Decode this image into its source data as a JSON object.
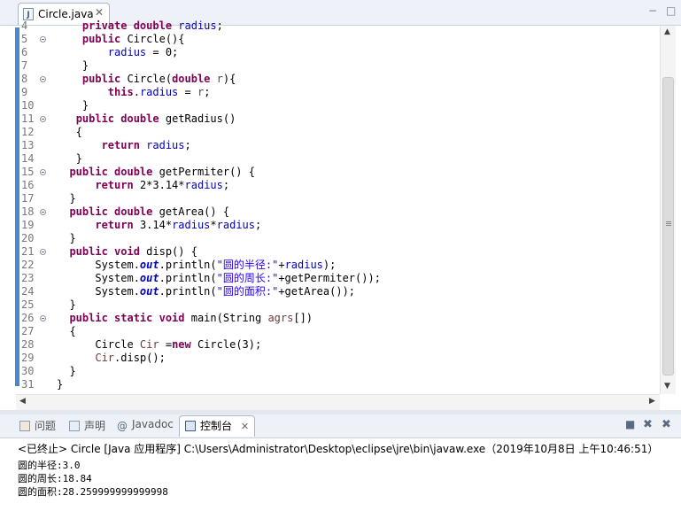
{
  "editor_tab": {
    "filename": "Circle.java",
    "close_glyph": "✕"
  },
  "window_controls": {
    "minimize": "−",
    "maximize": "□"
  },
  "code_lines": [
    {
      "n": "4",
      "fold": false,
      "tokens": [
        [
          "    ",
          ""
        ],
        [
          "private double ",
          "kw"
        ],
        [
          "radius",
          "fld"
        ],
        [
          ";",
          ""
        ]
      ]
    },
    {
      "n": "5",
      "fold": true,
      "tokens": [
        [
          "    ",
          ""
        ],
        [
          "public ",
          "kw"
        ],
        [
          "Circle(){",
          ""
        ]
      ]
    },
    {
      "n": "6",
      "fold": false,
      "tokens": [
        [
          "        ",
          ""
        ],
        [
          "radius",
          "fld"
        ],
        [
          " = 0;",
          ""
        ]
      ]
    },
    {
      "n": "7",
      "fold": false,
      "tokens": [
        [
          "    }",
          ""
        ]
      ]
    },
    {
      "n": "8",
      "fold": true,
      "tokens": [
        [
          "    ",
          ""
        ],
        [
          "public ",
          "kw"
        ],
        [
          "Circle(",
          ""
        ],
        [
          "double ",
          "kw"
        ],
        [
          "r",
          "vr"
        ],
        [
          "){",
          ""
        ]
      ]
    },
    {
      "n": "9",
      "fold": false,
      "tokens": [
        [
          "        ",
          ""
        ],
        [
          "this",
          "kw"
        ],
        [
          ".",
          ""
        ],
        [
          "radius",
          "fld"
        ],
        [
          " = ",
          ""
        ],
        [
          "r",
          "vr"
        ],
        [
          ";",
          ""
        ]
      ]
    },
    {
      "n": "10",
      "fold": false,
      "tokens": [
        [
          "    }",
          ""
        ]
      ]
    },
    {
      "n": "11",
      "fold": true,
      "tokens": [
        [
          "   ",
          ""
        ],
        [
          "public double ",
          "kw"
        ],
        [
          "getRadius()",
          ""
        ]
      ]
    },
    {
      "n": "12",
      "fold": false,
      "tokens": [
        [
          "   {",
          ""
        ]
      ]
    },
    {
      "n": "13",
      "fold": false,
      "tokens": [
        [
          "       ",
          ""
        ],
        [
          "return ",
          "kw"
        ],
        [
          "radius",
          "fld"
        ],
        [
          ";",
          ""
        ]
      ]
    },
    {
      "n": "14",
      "fold": false,
      "tokens": [
        [
          "   }",
          ""
        ]
      ]
    },
    {
      "n": "15",
      "fold": true,
      "tokens": [
        [
          "  ",
          ""
        ],
        [
          "public double ",
          "kw"
        ],
        [
          "getPermiter() {",
          ""
        ]
      ]
    },
    {
      "n": "16",
      "fold": false,
      "tokens": [
        [
          "      ",
          ""
        ],
        [
          "return ",
          "kw"
        ],
        [
          "2*3.14*",
          ""
        ],
        [
          "radius",
          "fld"
        ],
        [
          ";",
          ""
        ]
      ]
    },
    {
      "n": "17",
      "fold": false,
      "tokens": [
        [
          "  }",
          ""
        ]
      ]
    },
    {
      "n": "18",
      "fold": true,
      "tokens": [
        [
          "  ",
          ""
        ],
        [
          "public double ",
          "kw"
        ],
        [
          "getArea() {",
          ""
        ]
      ]
    },
    {
      "n": "19",
      "fold": false,
      "tokens": [
        [
          "      ",
          ""
        ],
        [
          "return ",
          "kw"
        ],
        [
          "3.14*",
          ""
        ],
        [
          "radius",
          "fld"
        ],
        [
          "*",
          ""
        ],
        [
          "radius",
          "fld"
        ],
        [
          ";",
          ""
        ]
      ]
    },
    {
      "n": "20",
      "fold": false,
      "tokens": [
        [
          "  }",
          ""
        ]
      ]
    },
    {
      "n": "21",
      "fold": true,
      "tokens": [
        [
          "  ",
          ""
        ],
        [
          "public void ",
          "kw"
        ],
        [
          "disp() {",
          ""
        ]
      ]
    },
    {
      "n": "22",
      "fold": false,
      "tokens": [
        [
          "      System.",
          ""
        ],
        [
          "out",
          "sta"
        ],
        [
          ".println(",
          ""
        ],
        [
          "\"圆的半径:\"",
          "str"
        ],
        [
          "+",
          ""
        ],
        [
          "radius",
          "fld"
        ],
        [
          ");",
          ""
        ]
      ]
    },
    {
      "n": "23",
      "fold": false,
      "tokens": [
        [
          "      System.",
          ""
        ],
        [
          "out",
          "sta"
        ],
        [
          ".println(",
          ""
        ],
        [
          "\"圆的周长:\"",
          "str"
        ],
        [
          "+getPermiter());",
          ""
        ]
      ]
    },
    {
      "n": "24",
      "fold": false,
      "tokens": [
        [
          "      System.",
          ""
        ],
        [
          "out",
          "sta"
        ],
        [
          ".println(",
          ""
        ],
        [
          "\"圆的面积:\"",
          "str"
        ],
        [
          "+getArea());",
          ""
        ]
      ]
    },
    {
      "n": "25",
      "fold": false,
      "tokens": [
        [
          "  }",
          ""
        ]
      ]
    },
    {
      "n": "26",
      "fold": true,
      "tokens": [
        [
          "  ",
          ""
        ],
        [
          "public static void ",
          "kw"
        ],
        [
          "main(String ",
          ""
        ],
        [
          "agrs",
          "vr"
        ],
        [
          "[])",
          ""
        ]
      ]
    },
    {
      "n": "27",
      "fold": false,
      "tokens": [
        [
          "  {",
          ""
        ]
      ]
    },
    {
      "n": "28",
      "fold": false,
      "tokens": [
        [
          "      Circle ",
          ""
        ],
        [
          "Cir",
          "vr"
        ],
        [
          " =",
          ""
        ],
        [
          "new ",
          "kw"
        ],
        [
          "Circle(3);",
          ""
        ]
      ]
    },
    {
      "n": "29",
      "fold": false,
      "tokens": [
        [
          "      ",
          ""
        ],
        [
          "Cir",
          "vr"
        ],
        [
          ".disp();",
          ""
        ]
      ]
    },
    {
      "n": "30",
      "fold": false,
      "tokens": [
        [
          "  }",
          ""
        ]
      ]
    },
    {
      "n": "31",
      "fold": false,
      "tokens": [
        [
          "}",
          ""
        ]
      ]
    }
  ],
  "panel_tabs": [
    {
      "label": "问题",
      "icon": "problems-icon",
      "active": false
    },
    {
      "label": "声明",
      "icon": "declaration-icon",
      "active": false
    },
    {
      "label": "Javadoc",
      "icon": "javadoc-icon",
      "active": false
    },
    {
      "label": "控制台",
      "icon": "console-icon",
      "active": true
    }
  ],
  "console": {
    "terminated_line": "<已终止> Circle [Java 应用程序] C:\\Users\\Administrator\\Desktop\\eclipse\\jre\\bin\\javaw.exe（2019年10月8日 上午10:46:51）",
    "output": [
      "圆的半径:3.0",
      "圆的周长:18.84",
      "圆的面积:28.259999999999998"
    ]
  },
  "colors": {
    "keyword": "#7f0055",
    "field": "#0000c0",
    "string": "#2a00ff",
    "left_ruler": "#4c86d1"
  }
}
